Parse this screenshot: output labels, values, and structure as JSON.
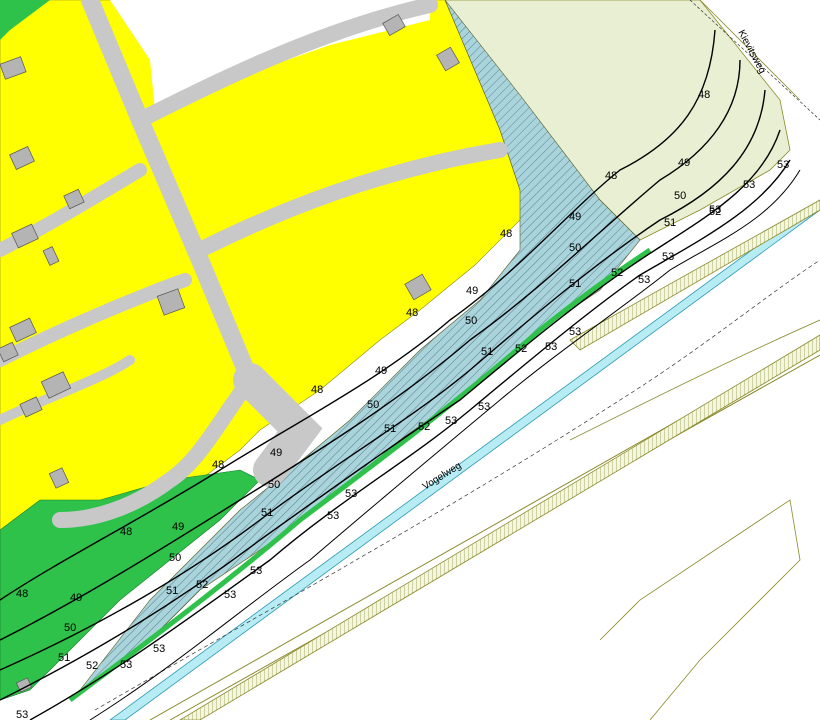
{
  "map": {
    "road_labels": {
      "vogelweg": "Vogelweg",
      "kievitsweg": "Kievitsweg"
    },
    "contour_levels": [
      "48",
      "49",
      "50",
      "51",
      "52",
      "53"
    ],
    "colors": {
      "residential": "#ffff00",
      "green_zone": "#2ec24a",
      "hatched_zone": "#a9d4dc",
      "meadow": "#e8efd2",
      "road": "#c8c8c8",
      "building": "#b4b4b4",
      "contour": "#000000",
      "water": "#b8ecf5",
      "outline": "#8a8a2a"
    },
    "icons": [
      "building-icon"
    ]
  }
}
